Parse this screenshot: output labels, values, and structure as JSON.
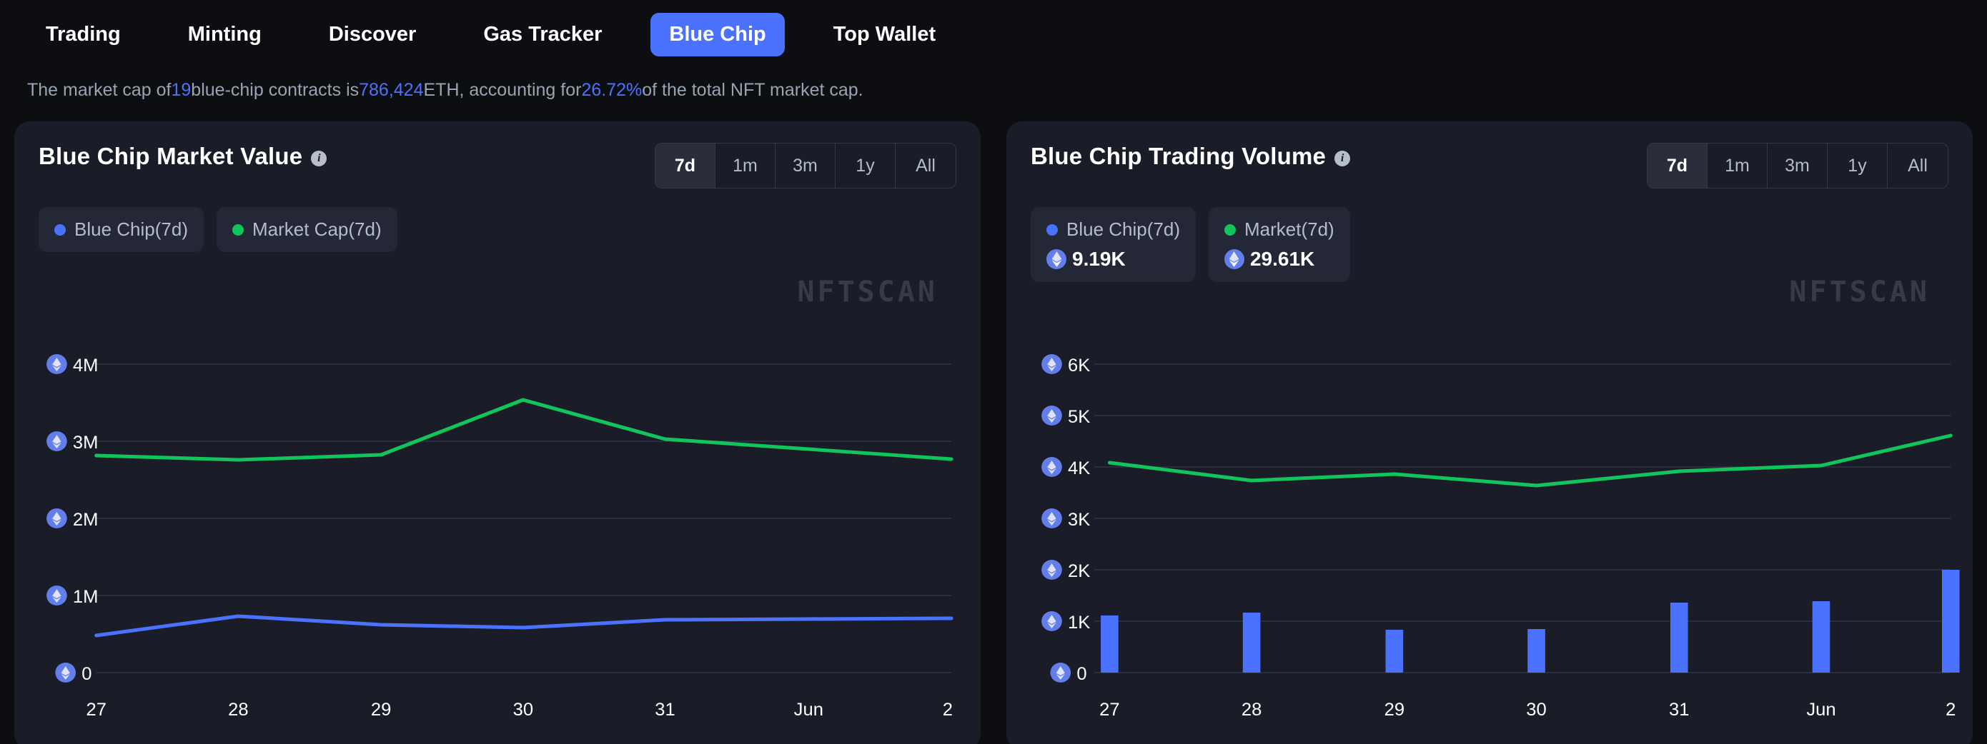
{
  "nav": {
    "items": [
      {
        "label": "Trading",
        "active": false
      },
      {
        "label": "Minting",
        "active": false
      },
      {
        "label": "Discover",
        "active": false
      },
      {
        "label": "Gas Tracker",
        "active": false
      },
      {
        "label": "Blue Chip",
        "active": true
      },
      {
        "label": "Top Wallet",
        "active": false
      }
    ]
  },
  "summary": {
    "part1": "The market cap of ",
    "count": "19",
    "part2": " blue-chip contracts is ",
    "eth_amount": "786,424",
    "part3": " ETH, accounting for ",
    "percent": "26.72%",
    "part4": " of the total NFT market cap."
  },
  "colors": {
    "accent_blue": "#4a72ff",
    "accent_green": "#12c45c",
    "page_bg": "#0d0e12",
    "card_bg": "#1a1d27",
    "grid": "#2e3546"
  },
  "watermark": "NFTSCAN",
  "ranges": [
    "7d",
    "1m",
    "3m",
    "1y",
    "All"
  ],
  "active_range": "7d",
  "left_card": {
    "title": "Blue Chip Market Value",
    "info_icon": "info-icon",
    "legend": [
      {
        "label": "Blue Chip(7d)",
        "color": "blue"
      },
      {
        "label": "Market Cap(7d)",
        "color": "green"
      }
    ]
  },
  "right_card": {
    "title": "Blue Chip Trading Volume",
    "info_icon": "info-icon",
    "legend": [
      {
        "label": "Blue Chip(7d)",
        "color": "blue",
        "value": "9.19K",
        "icon": "eth-icon"
      },
      {
        "label": "Market(7d)",
        "color": "green",
        "value": "29.61K",
        "icon": "eth-icon"
      }
    ]
  },
  "chart_data": [
    {
      "type": "line",
      "title": "Blue Chip Market Value",
      "xlabel": "",
      "ylabel": "ETH",
      "x": [
        "27",
        "28",
        "29",
        "30",
        "31",
        "Jun",
        "2"
      ],
      "yticks": [
        "0",
        "1M",
        "2M",
        "3M",
        "4M"
      ],
      "ytick_values": [
        0,
        1000000,
        2000000,
        3000000,
        4000000
      ],
      "ylim": [
        0,
        4300000
      ],
      "grid": true,
      "legend_position": "top-left",
      "series": [
        {
          "name": "Market Cap(7d)",
          "color": "#12c45c",
          "values": [
            3020000,
            2960000,
            3030000,
            3800000,
            3250000,
            3120000,
            2980000
          ]
        },
        {
          "name": "Blue Chip(7d)",
          "color": "#4a72ff",
          "values": [
            520000,
            790000,
            670000,
            630000,
            740000,
            750000,
            755000
          ]
        }
      ]
    },
    {
      "type": "line+bar",
      "title": "Blue Chip Trading Volume",
      "xlabel": "",
      "ylabel": "ETH",
      "x": [
        "27",
        "28",
        "29",
        "30",
        "31",
        "Jun",
        "2"
      ],
      "yticks": [
        "0",
        "1K",
        "2K",
        "3K",
        "4K",
        "5K",
        "6K"
      ],
      "ytick_values": [
        0,
        1000,
        2000,
        3000,
        4000,
        5000,
        6000
      ],
      "ylim": [
        0,
        6400
      ],
      "grid": true,
      "legend_position": "top-left",
      "series": [
        {
          "name": "Market(7d)",
          "type": "line",
          "color": "#12c45c",
          "values": [
            4350,
            3980,
            4120,
            3880,
            4180,
            4300,
            4920
          ]
        },
        {
          "name": "Blue Chip(7d)",
          "type": "bar",
          "color": "#4a72ff",
          "values": [
            1180,
            1240,
            890,
            900,
            1450,
            1490,
            2140
          ]
        }
      ]
    }
  ]
}
